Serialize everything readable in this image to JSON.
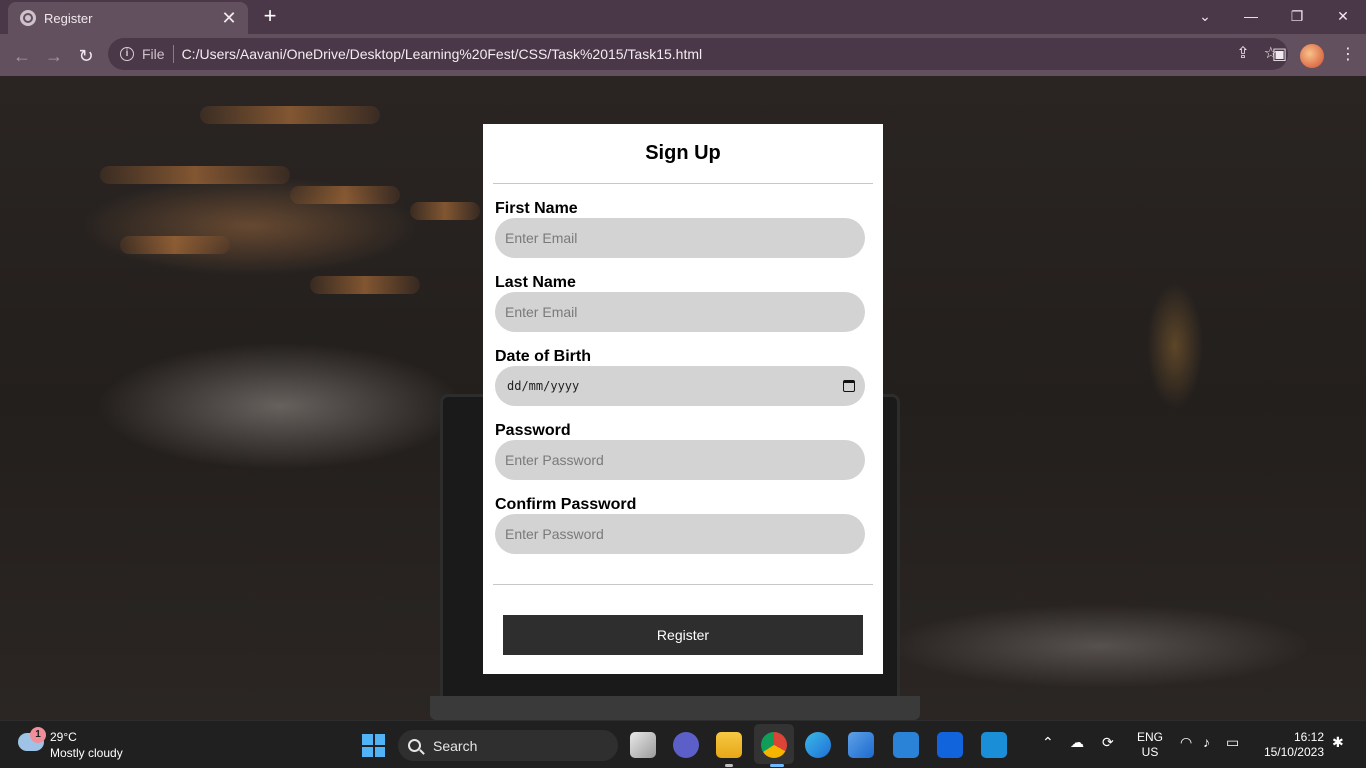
{
  "browser": {
    "tab_title": "Register",
    "tab_close": "✕",
    "new_tab": "+",
    "address_prefix": "File",
    "url": "C:/Users/Aavani/OneDrive/Desktop/Learning%20Fest/CSS/Task%2015/Task15.html"
  },
  "form": {
    "title": "Sign Up",
    "first_name_label": "First Name",
    "first_name_placeholder": "Enter Email",
    "last_name_label": "Last Name",
    "last_name_placeholder": "Enter Email",
    "dob_label": "Date of Birth",
    "dob_placeholder": "dd/mm/yyyy",
    "password_label": "Password",
    "password_placeholder": "Enter Password",
    "confirm_password_label": "Confirm Password",
    "confirm_password_placeholder": "Enter Password",
    "register_label": "Register"
  },
  "taskbar": {
    "weather_badge": "1",
    "weather_temp": "29°C",
    "weather_desc": "Mostly cloudy",
    "search_label": "Search",
    "lang_line1": "ENG",
    "lang_line2": "US",
    "time": "16:12",
    "date": "15/10/2023"
  }
}
